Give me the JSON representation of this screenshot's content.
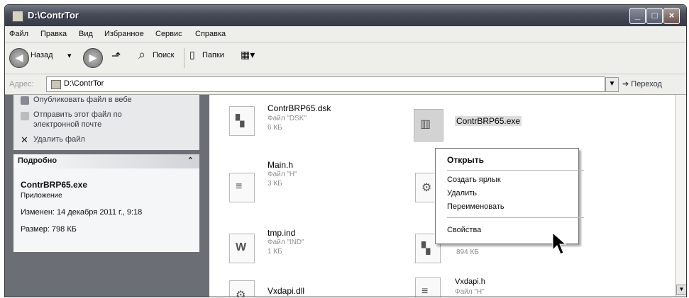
{
  "window": {
    "title": "D:\\ContrTor"
  },
  "menu": [
    "Файл",
    "Правка",
    "Вид",
    "Избранное",
    "Сервис",
    "Справка"
  ],
  "toolbar": {
    "back": "Назад",
    "search": "Поиск",
    "folders": "Папки"
  },
  "address": {
    "label": "Адрес:",
    "value": "D:\\ContrTor",
    "go": "Переход"
  },
  "tasks": [
    "Опубликовать файл в вебе",
    "Отправить этот файл по",
    "электронной почте",
    "Удалить файл"
  ],
  "details": {
    "header": "Подробно",
    "name": "ContrBRP65.exe",
    "type": "Приложение",
    "modified": "Изменен: 14 декабря 2011 г., 9:18",
    "size": "Размер: 798 КБ"
  },
  "files": [
    {
      "name": "ContrBRP65.dsk",
      "type": "Файл \"DSK\"",
      "size": "6 КБ",
      "icon": "dsk-file-icon"
    },
    {
      "name": "Main.h",
      "type": "Файл \"H\"",
      "size": "3 КБ",
      "icon": "h-file-icon"
    },
    {
      "name": "tmp.ind",
      "type": "Файл \"IND\"",
      "size": "1 КБ",
      "icon": "word-file-icon"
    },
    {
      "name": "Vxdapi.dll",
      "type": "",
      "size": "",
      "icon": "dll-file-icon"
    },
    {
      "name": "ContrBRP65.exe",
      "type": "",
      "size": "",
      "icon": "exe-file-icon"
    },
    {
      "name": "",
      "type": "",
      "size": "894 КБ",
      "icon": "project-file-icon"
    },
    {
      "name": "Vxdapi.h",
      "type": "Файл \"H\"",
      "size": "",
      "icon": "h-file-icon"
    }
  ],
  "context_menu": {
    "open": "Открыть",
    "shortcut": "Создать ярлык",
    "delete": "Удалить",
    "rename": "Переименовать",
    "properties": "Свойства"
  }
}
